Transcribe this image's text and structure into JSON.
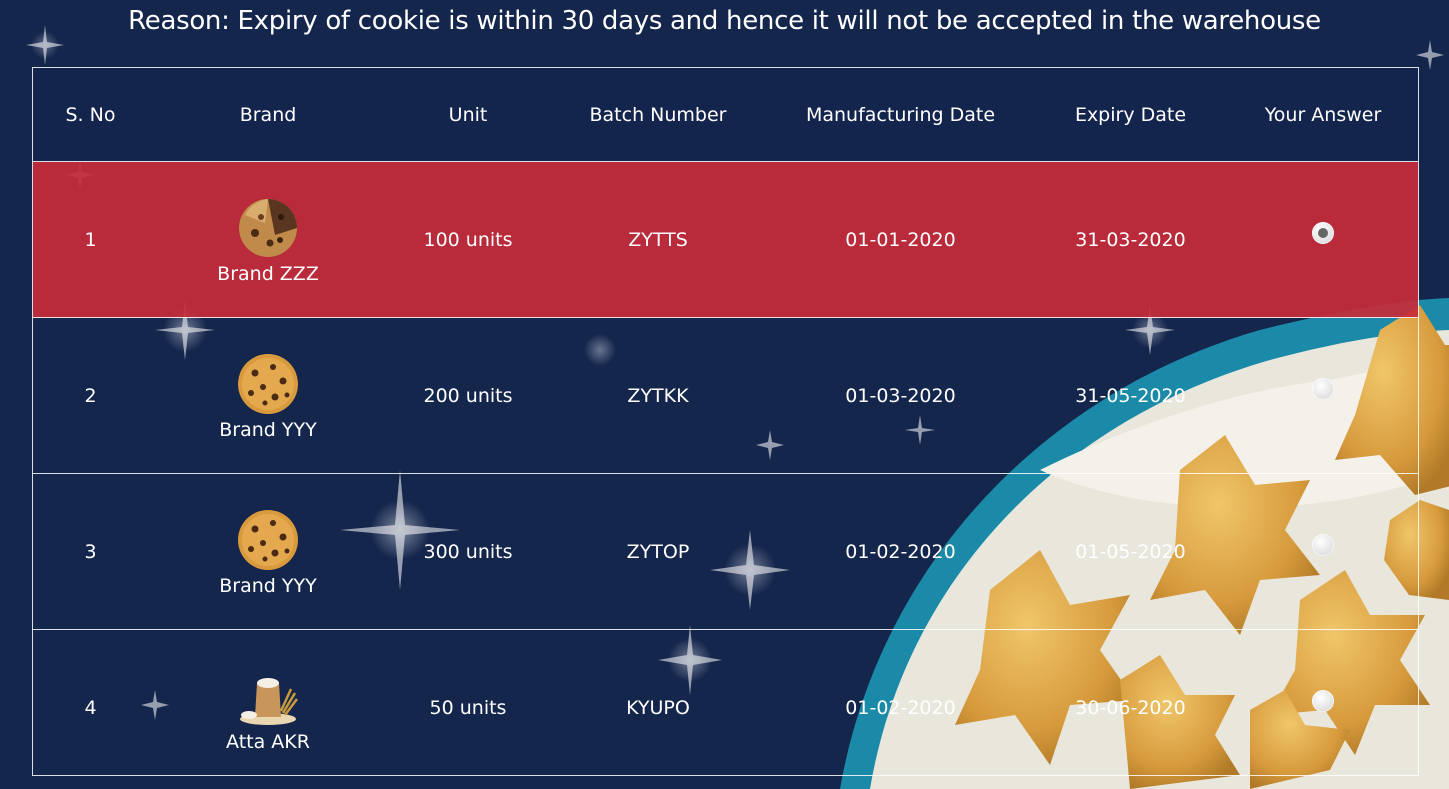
{
  "headline": "Reason: Expiry of cookie is within 30 days and hence it will not be accepted in the warehouse",
  "columns": [
    "S. No",
    "Brand",
    "Unit",
    "Batch Number",
    "Manufacturing Date",
    "Expiry Date",
    "Your Answer"
  ],
  "rows": [
    {
      "sno": "1",
      "brand": "Brand ZZZ",
      "image": "chocolate-cookie-icon",
      "unit": "100 units",
      "batch": "ZYTTS",
      "mfg": "01-01-2020",
      "expiry": "31-03-2020",
      "selected": true
    },
    {
      "sno": "2",
      "brand": "Brand YYY",
      "image": "chip-cookie-icon",
      "unit": "200 units",
      "batch": "ZYTKK",
      "mfg": "01-03-2020",
      "expiry": "31-05-2020",
      "selected": false
    },
    {
      "sno": "3",
      "brand": "Brand YYY",
      "image": "chip-cookie-icon",
      "unit": "300 units",
      "batch": "ZYTOP",
      "mfg": "01-02-2020",
      "expiry": "01-05-2020",
      "selected": false
    },
    {
      "sno": "4",
      "brand": "Atta AKR",
      "image": "flour-sack-icon",
      "unit": "50 units",
      "batch": "KYUPO",
      "mfg": "01-02-2020",
      "expiry": "30-06-2020",
      "selected": false
    }
  ],
  "colors": {
    "background": "#15264d",
    "selected_row": "#c62c3a",
    "border": "#ffffff"
  }
}
